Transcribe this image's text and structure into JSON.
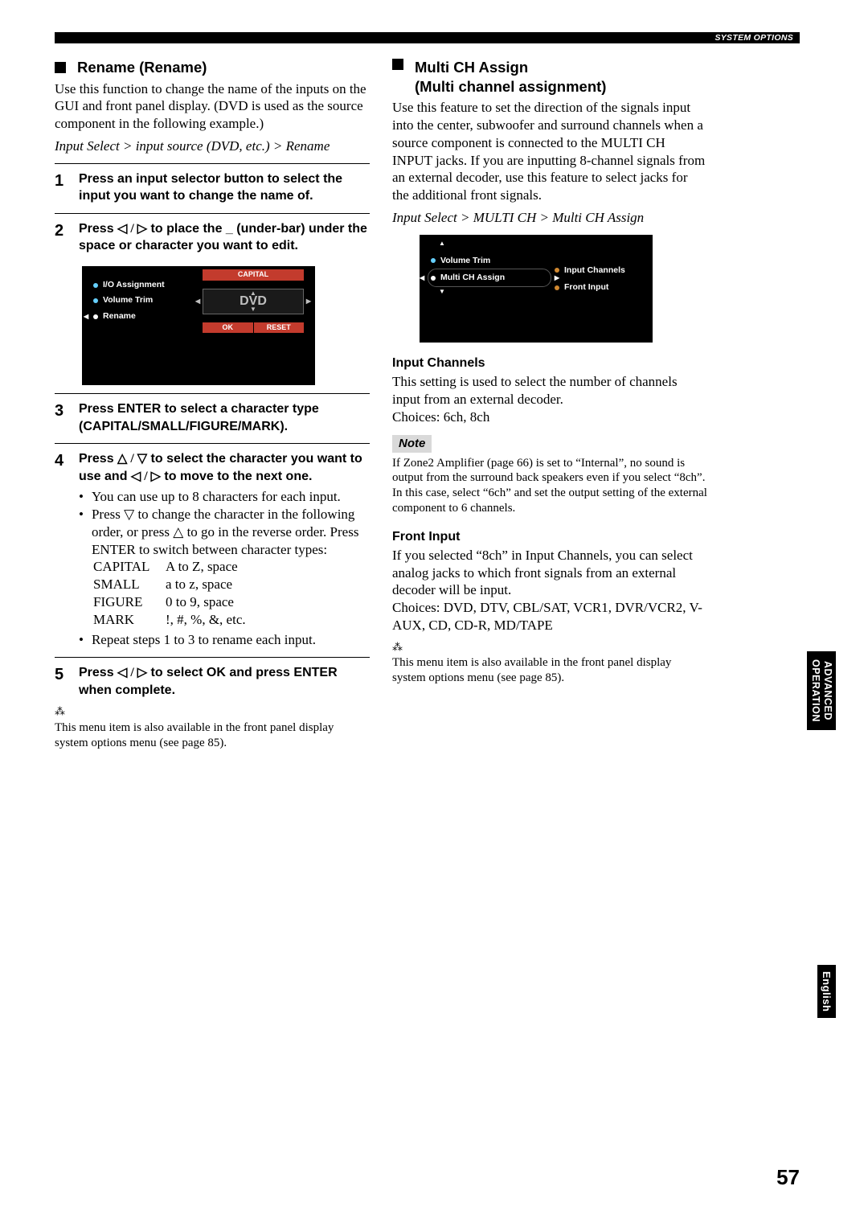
{
  "header": {
    "system_options": "SYSTEM OPTIONS"
  },
  "left": {
    "title": "Rename (Rename)",
    "intro": "Use this function to change the name of the inputs on the GUI and front panel display. (DVD is used as the source component in the following example.)",
    "crumb": "Input Select > input source (DVD, etc.) > Rename",
    "step1": "Press an input selector button to select the input you want to change the name of.",
    "step2_a": "Press ",
    "step2_b": " to place the _ (under-bar) under the space or character you want to edit.",
    "gui1": {
      "m1": "I/O Assignment",
      "m2": "Volume Trim",
      "m3": "Rename",
      "cap": "CAPITAL",
      "val": "DVD",
      "ok": "OK",
      "reset": "RESET"
    },
    "step3": "Press ENTER to select a character type (CAPITAL/SMALL/FIGURE/MARK).",
    "step4_a": "Press ",
    "step4_b": " to select the character you want to use and ",
    "step4_c": " to move to the next one.",
    "b1": "You can use up to 8 characters for each input.",
    "b2_a": "Press ",
    "b2_b": " to change the character in the following order, or press ",
    "b2_c": " to go in the reverse order. Press ENTER to switch between character types:",
    "tbl": {
      "r1l": "CAPITAL",
      "r1r": "A to Z, space",
      "r2l": "SMALL",
      "r2r": "a to z, space",
      "r3l": "FIGURE",
      "r3r": "0 to 9, space",
      "r4l": "MARK",
      "r4r": "!, #, %, &, etc."
    },
    "b3": "Repeat steps 1 to 3 to rename each input.",
    "step5_a": "Press ",
    "step5_b": " to select OK and press ENTER when complete.",
    "tip": "This menu item is also available in the front panel display system options menu (see page 85)."
  },
  "right": {
    "title1": "Multi CH Assign",
    "title2": "(Multi channel assignment)",
    "intro": "Use this feature to set the direction of the signals input into the center, subwoofer and surround channels when a source component is connected to the MULTI CH INPUT jacks. If you are inputting 8-channel signals from an external decoder, use this feature to select jacks for the additional front signals.",
    "crumb": "Input Select > MULTI CH > Multi CH Assign",
    "gui2": {
      "m1": "Volume Trim",
      "m2": "Multi CH Assign",
      "r1": "Input Channels",
      "r2": "Front Input"
    },
    "ic_h": "Input Channels",
    "ic_p": "This setting is used to select the number of channels input from an external decoder.",
    "ic_c": "Choices: 6ch, 8ch",
    "note_label": "Note",
    "note_p": "If Zone2 Amplifier (page 66) is set to “Internal”, no sound is output from the surround back speakers even if you select “8ch”. In this case, select “6ch” and set the output setting of the external component to 6 channels.",
    "fi_h": "Front Input",
    "fi_p": "If you selected “8ch” in Input Channels, you can select analog jacks to which front signals from an external decoder will be input.",
    "fi_c": "Choices: DVD, DTV, CBL/SAT, VCR1, DVR/VCR2, V-AUX, CD, CD-R, MD/TAPE",
    "tip": "This menu item is also available in the front panel display system options menu (see page 85)."
  },
  "side": {
    "tab1a": "ADVANCED",
    "tab1b": "OPERATION",
    "tab2": "English"
  },
  "glyph": {
    "lr": "◁ / ▷",
    "ud": "△ / ▽",
    "down": "▽",
    "up": "△",
    "spark": "⁂"
  },
  "pagenum": "57"
}
